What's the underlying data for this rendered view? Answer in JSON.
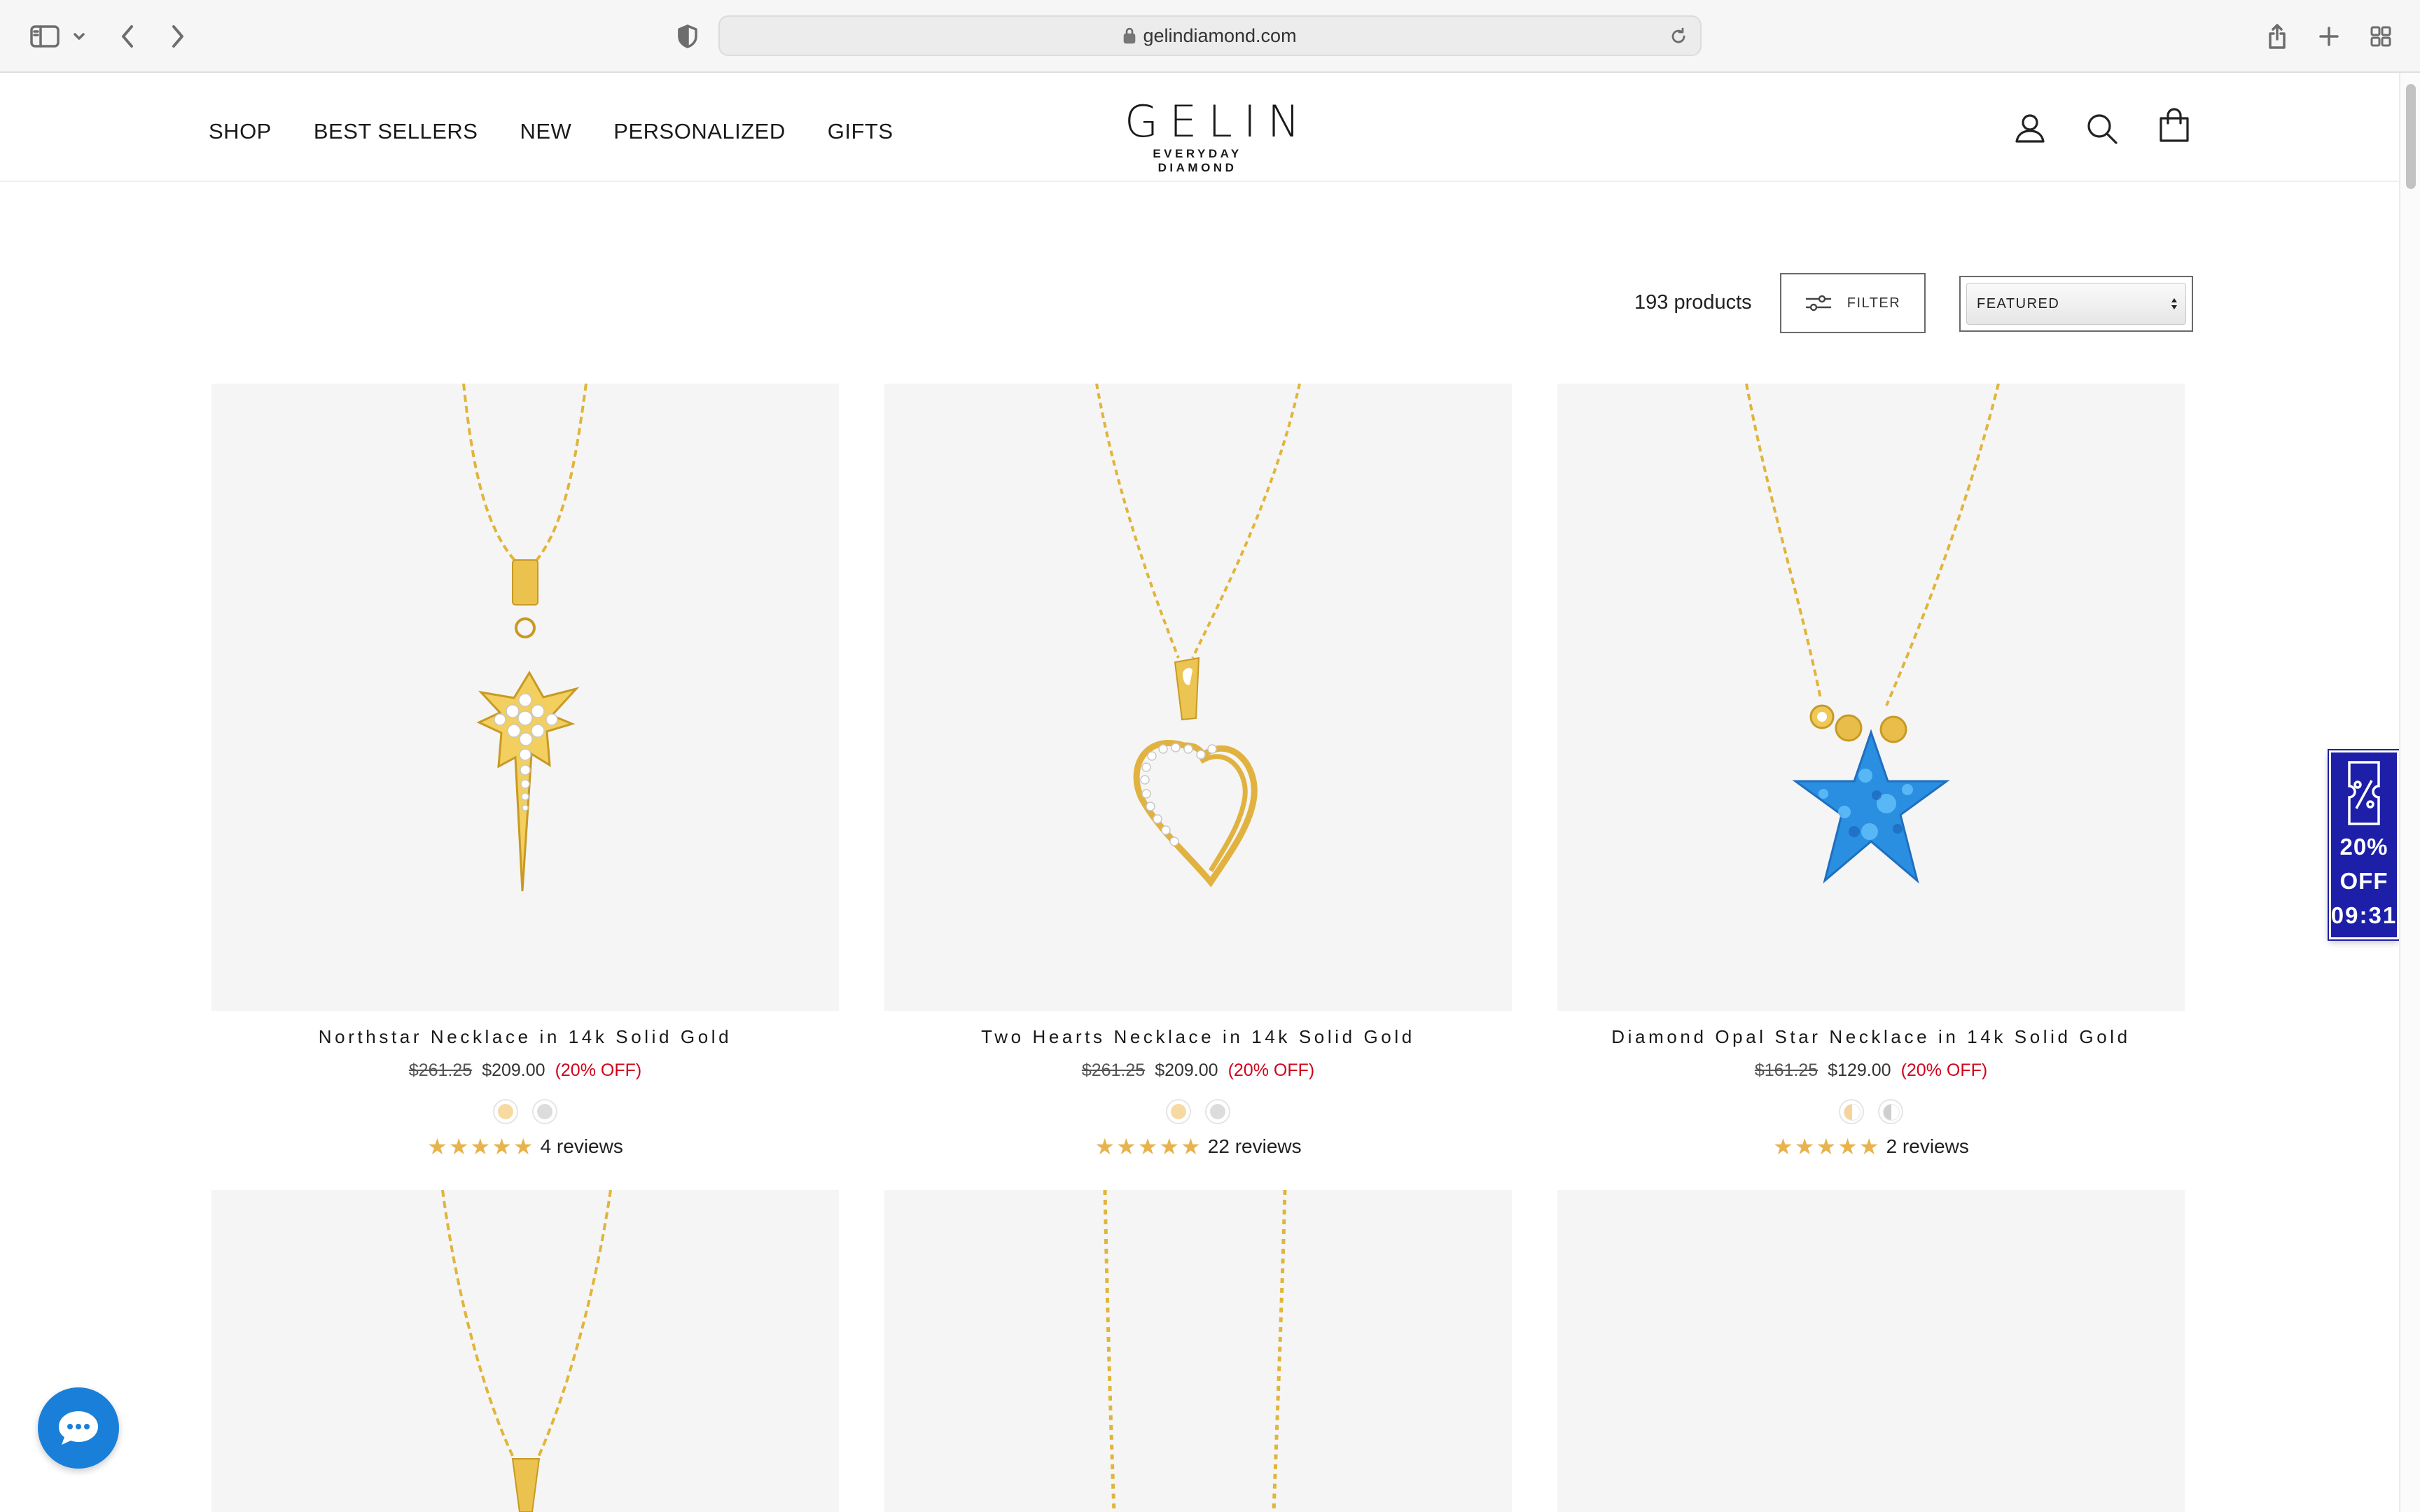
{
  "browser": {
    "url": "gelindiamond.com",
    "icons": [
      "sidebar-icon",
      "chevron-down-icon",
      "back-icon",
      "forward-icon",
      "shield-icon",
      "lock-icon",
      "reload-icon",
      "share-icon",
      "new-tab-icon",
      "tab-overview-icon"
    ]
  },
  "header": {
    "nav": [
      "SHOP",
      "BEST SELLERS",
      "NEW",
      "PERSONALIZED",
      "GIFTS"
    ],
    "logo_word": "GELIN",
    "logo_tagline": "EVERYDAY DIAMOND",
    "icons": [
      "account-icon",
      "search-icon",
      "cart-icon"
    ]
  },
  "toolbar": {
    "count": "193 products",
    "filter_label": "FILTER",
    "sort_selected": "FEATURED"
  },
  "products": [
    {
      "title": "Northstar Necklace in 14k Solid Gold",
      "old_price": "$261.25",
      "price": "$209.00",
      "discount": "(20% OFF)",
      "swatches": [
        "gold",
        "silver"
      ],
      "rating": 5,
      "reviews": "4 reviews",
      "image": "star-pendant"
    },
    {
      "title": "Two Hearts Necklace in 14k Solid Gold",
      "old_price": "$261.25",
      "price": "$209.00",
      "discount": "(20% OFF)",
      "swatches": [
        "gold",
        "silver"
      ],
      "rating": 5,
      "reviews": "22 reviews",
      "image": "heart-pendant"
    },
    {
      "title": "Diamond Opal Star Necklace in 14k Solid Gold",
      "old_price": "$161.25",
      "price": "$129.00",
      "discount": "(20% OFF)",
      "swatches": [
        "gold-half",
        "silver-half"
      ],
      "rating": 5,
      "reviews": "2 reviews",
      "image": "opal-star-pendant"
    }
  ],
  "promo": {
    "line1": "20%",
    "line2": "OFF",
    "timer": "09:31"
  },
  "colors": {
    "sale_red": "#d0021b",
    "star_gold": "#e8b34c",
    "promo_blue": "#1d1fa8",
    "chat_blue": "#1a7fd9",
    "gold_chain": "#e0b53a",
    "opal_blue": "#2a8fe0"
  }
}
